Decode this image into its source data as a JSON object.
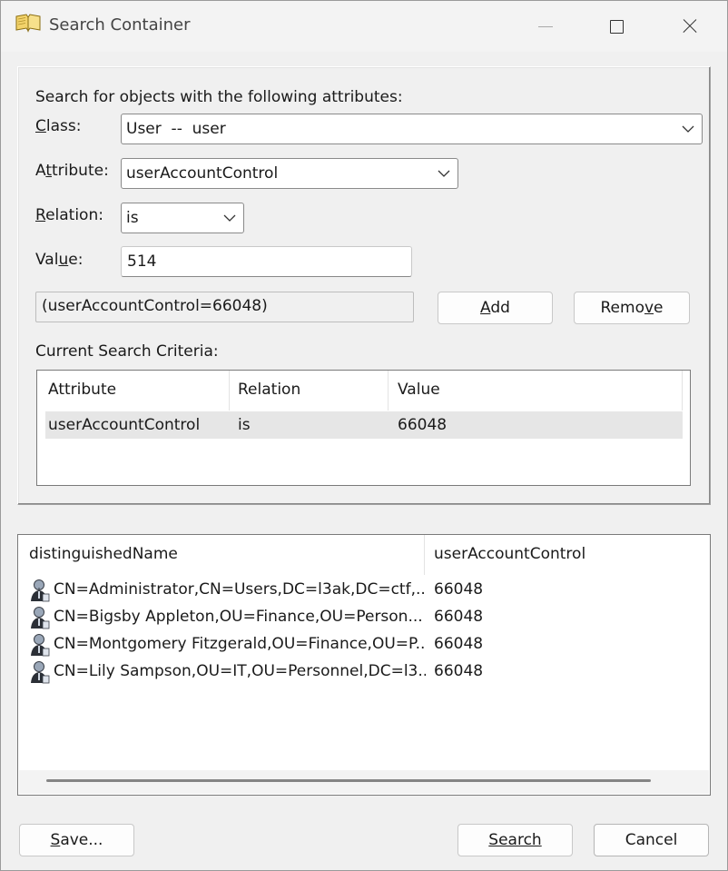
{
  "window": {
    "title": "Search Container"
  },
  "criteria": {
    "intro": "Search for objects with the following attributes:",
    "class_label_u": "C",
    "class_label_rest": "lass:",
    "class_value": "User  --  user",
    "attribute_label_pre": "A",
    "attribute_label_u": "t",
    "attribute_label_rest": "tribute:",
    "attribute_value": "userAccountControl",
    "relation_label_u": "R",
    "relation_label_rest": "elation:",
    "relation_value": "is",
    "value_label_pre": "Val",
    "value_label_u": "u",
    "value_label_rest": "e:",
    "value_input": "514",
    "filter_preview": "(userAccountControl=66048)",
    "add_u": "A",
    "add_rest": "dd",
    "remove_pre": "Remo",
    "remove_u": "v",
    "remove_rest": "e",
    "current_label": "Current Search Criteria:",
    "table": {
      "headers": [
        "Attribute",
        "Relation",
        "Value"
      ],
      "rows": [
        {
          "attribute": "userAccountControl",
          "relation": "is",
          "value": "66048"
        }
      ]
    }
  },
  "results": {
    "headers": [
      "distinguishedName",
      "userAccountControl"
    ],
    "icon": "user-icon",
    "rows": [
      {
        "dn": "CN=Administrator,CN=Users,DC=l3ak,DC=ctf,...",
        "uac": "66048"
      },
      {
        "dn": "CN=Bigsby Appleton,OU=Finance,OU=Person...",
        "uac": "66048"
      },
      {
        "dn": "CN=Montgomery Fitzgerald,OU=Finance,OU=P...",
        "uac": "66048"
      },
      {
        "dn": "CN=Lily Sampson,OU=IT,OU=Personnel,DC=l3...",
        "uac": "66048"
      }
    ]
  },
  "footer": {
    "save_u": "S",
    "save_rest": "ave...",
    "search_pre": "Search",
    "cancel": "Cancel"
  }
}
